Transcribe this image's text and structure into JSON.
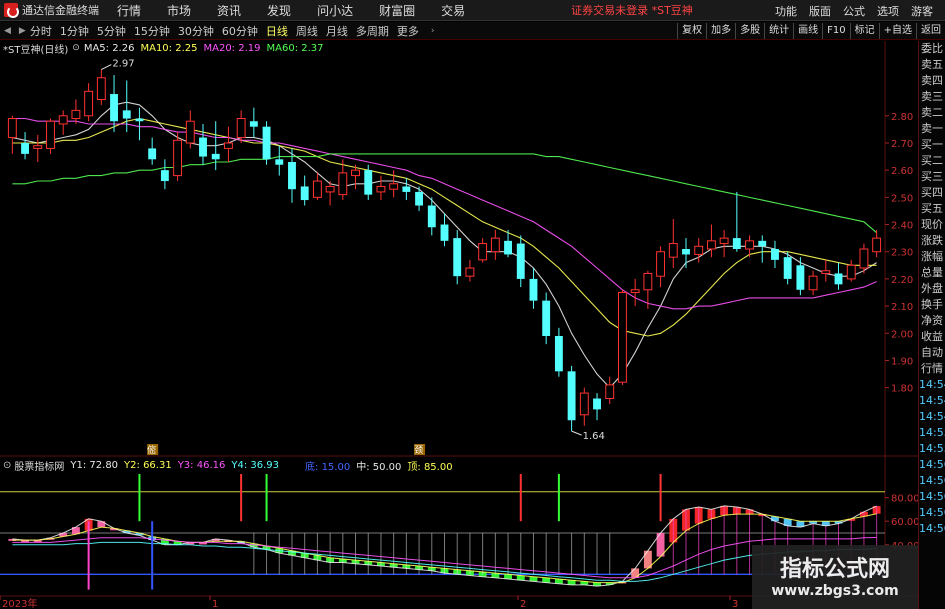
{
  "menu": {
    "app_name": "通达信金融终端",
    "items": [
      "行情",
      "市场",
      "资讯",
      "发现",
      "问小达",
      "财富圈",
      "交易"
    ],
    "notice": "证券交易未登录 *ST豆神",
    "right_items": [
      "功能",
      "版面",
      "公式",
      "选项",
      "游客"
    ]
  },
  "toolbar": {
    "periods": [
      "分时",
      "1分钟",
      "5分钟",
      "15分钟",
      "30分钟",
      "60分钟",
      "日线",
      "周线",
      "月线",
      "多周期",
      "更多"
    ],
    "active_period": "日线",
    "right_buttons": [
      "复权",
      "加多",
      "多股",
      "统计",
      "画线",
      "F10",
      "标记",
      "+自选",
      "返回"
    ]
  },
  "ma_legend": {
    "title": "*ST豆神(日线)",
    "items": [
      {
        "label": "MA5: 2.26",
        "color": "#e8e8e8"
      },
      {
        "label": "MA10: 2.25",
        "color": "#ffff55"
      },
      {
        "label": "MA20: 2.19",
        "color": "#ff55ff"
      },
      {
        "label": "MA60: 2.37",
        "color": "#55ff55"
      }
    ]
  },
  "indicator_legend": {
    "name": "股票指标网",
    "items": [
      {
        "label": "Y1: 72.80",
        "color": "#e8e8e8"
      },
      {
        "label": "Y2: 66.31",
        "color": "#ffff55"
      },
      {
        "label": "Y3: 46.16",
        "color": "#ff55ff"
      },
      {
        "label": "Y4: 36.93",
        "color": "#55ffff"
      },
      {
        "label": "底: 15.00",
        "color": "#4466ff"
      },
      {
        "label": "中: 50.00",
        "color": "#e8e8e8"
      },
      {
        "label": "顶: 85.00",
        "color": "#ffff55"
      }
    ]
  },
  "right_panel": [
    "委比",
    "卖五",
    "卖四",
    "卖三",
    "卖二",
    "卖一",
    "买一",
    "买二",
    "买三",
    "买四",
    "买五",
    "现价",
    "涨跌",
    "涨幅",
    "总量",
    "外盘",
    "换手",
    "净资",
    "收益",
    "自动",
    "行情",
    "14:54",
    "14:54",
    "14:54",
    "14:55",
    "14:55",
    "14:56",
    "14:56",
    "14:56",
    "14:56",
    "14:56"
  ],
  "chart_data": {
    "type": "candlestick",
    "price_axis": {
      "ylim": [
        1.6,
        3.02
      ],
      "ticks": [
        "2.80",
        "2.70",
        "2.60",
        "2.50",
        "2.40",
        "2.30",
        "2.20",
        "2.10",
        "2.00",
        "1.90",
        "1.80"
      ]
    },
    "annotations": {
      "high": "2.97",
      "low": "1.64",
      "flag_1": "㑻",
      "flag_2": "颈"
    },
    "candles": [
      {
        "o": 2.72,
        "h": 2.8,
        "l": 2.66,
        "c": 2.79
      },
      {
        "o": 2.7,
        "h": 2.74,
        "l": 2.64,
        "c": 2.66
      },
      {
        "o": 2.68,
        "h": 2.73,
        "l": 2.63,
        "c": 2.69
      },
      {
        "o": 2.68,
        "h": 2.79,
        "l": 2.66,
        "c": 2.78
      },
      {
        "o": 2.77,
        "h": 2.82,
        "l": 2.73,
        "c": 2.8
      },
      {
        "o": 2.79,
        "h": 2.86,
        "l": 2.77,
        "c": 2.82
      },
      {
        "o": 2.8,
        "h": 2.92,
        "l": 2.78,
        "c": 2.89
      },
      {
        "o": 2.86,
        "h": 2.97,
        "l": 2.84,
        "c": 2.94
      },
      {
        "o": 2.88,
        "h": 2.95,
        "l": 2.74,
        "c": 2.78
      },
      {
        "o": 2.82,
        "h": 2.93,
        "l": 2.74,
        "c": 2.79
      },
      {
        "o": 2.79,
        "h": 2.83,
        "l": 2.71,
        "c": 2.78
      },
      {
        "o": 2.68,
        "h": 2.72,
        "l": 2.62,
        "c": 2.64
      },
      {
        "o": 2.6,
        "h": 2.64,
        "l": 2.53,
        "c": 2.56
      },
      {
        "o": 2.58,
        "h": 2.74,
        "l": 2.56,
        "c": 2.71
      },
      {
        "o": 2.7,
        "h": 2.82,
        "l": 2.68,
        "c": 2.78
      },
      {
        "o": 2.72,
        "h": 2.77,
        "l": 2.62,
        "c": 2.65
      },
      {
        "o": 2.66,
        "h": 2.78,
        "l": 2.6,
        "c": 2.64
      },
      {
        "o": 2.68,
        "h": 2.76,
        "l": 2.63,
        "c": 2.7
      },
      {
        "o": 2.72,
        "h": 2.82,
        "l": 2.7,
        "c": 2.79
      },
      {
        "o": 2.78,
        "h": 2.83,
        "l": 2.72,
        "c": 2.76
      },
      {
        "o": 2.76,
        "h": 2.78,
        "l": 2.62,
        "c": 2.64
      },
      {
        "o": 2.64,
        "h": 2.69,
        "l": 2.58,
        "c": 2.62
      },
      {
        "o": 2.63,
        "h": 2.68,
        "l": 2.48,
        "c": 2.53
      },
      {
        "o": 2.54,
        "h": 2.58,
        "l": 2.47,
        "c": 2.49
      },
      {
        "o": 2.5,
        "h": 2.59,
        "l": 2.49,
        "c": 2.56
      },
      {
        "o": 2.52,
        "h": 2.56,
        "l": 2.47,
        "c": 2.54
      },
      {
        "o": 2.51,
        "h": 2.64,
        "l": 2.49,
        "c": 2.59
      },
      {
        "o": 2.58,
        "h": 2.62,
        "l": 2.53,
        "c": 2.6
      },
      {
        "o": 2.6,
        "h": 2.62,
        "l": 2.49,
        "c": 2.51
      },
      {
        "o": 2.52,
        "h": 2.58,
        "l": 2.49,
        "c": 2.54
      },
      {
        "o": 2.53,
        "h": 2.6,
        "l": 2.5,
        "c": 2.55
      },
      {
        "o": 2.54,
        "h": 2.57,
        "l": 2.49,
        "c": 2.52
      },
      {
        "o": 2.52,
        "h": 2.54,
        "l": 2.45,
        "c": 2.47
      },
      {
        "o": 2.47,
        "h": 2.5,
        "l": 2.36,
        "c": 2.39
      },
      {
        "o": 2.4,
        "h": 2.44,
        "l": 2.32,
        "c": 2.34
      },
      {
        "o": 2.35,
        "h": 2.38,
        "l": 2.18,
        "c": 2.21
      },
      {
        "o": 2.21,
        "h": 2.27,
        "l": 2.19,
        "c": 2.24
      },
      {
        "o": 2.27,
        "h": 2.35,
        "l": 2.26,
        "c": 2.33
      },
      {
        "o": 2.3,
        "h": 2.38,
        "l": 2.27,
        "c": 2.35
      },
      {
        "o": 2.34,
        "h": 2.38,
        "l": 2.28,
        "c": 2.29
      },
      {
        "o": 2.33,
        "h": 2.36,
        "l": 2.17,
        "c": 2.2
      },
      {
        "o": 2.2,
        "h": 2.24,
        "l": 2.09,
        "c": 2.12
      },
      {
        "o": 2.12,
        "h": 2.15,
        "l": 1.96,
        "c": 1.99
      },
      {
        "o": 1.99,
        "h": 2.02,
        "l": 1.84,
        "c": 1.86
      },
      {
        "o": 1.86,
        "h": 1.88,
        "l": 1.64,
        "c": 1.68
      },
      {
        "o": 1.7,
        "h": 1.8,
        "l": 1.66,
        "c": 1.78
      },
      {
        "o": 1.76,
        "h": 1.78,
        "l": 1.68,
        "c": 1.72
      },
      {
        "o": 1.76,
        "h": 1.84,
        "l": 1.74,
        "c": 1.81
      },
      {
        "o": 1.82,
        "h": 2.16,
        "l": 1.81,
        "c": 2.15
      },
      {
        "o": 2.15,
        "h": 2.2,
        "l": 2.1,
        "c": 2.16
      },
      {
        "o": 2.16,
        "h": 2.23,
        "l": 2.09,
        "c": 2.22
      },
      {
        "o": 2.21,
        "h": 2.32,
        "l": 2.17,
        "c": 2.3
      },
      {
        "o": 2.28,
        "h": 2.42,
        "l": 2.24,
        "c": 2.33
      },
      {
        "o": 2.31,
        "h": 2.35,
        "l": 2.24,
        "c": 2.29
      },
      {
        "o": 2.29,
        "h": 2.35,
        "l": 2.26,
        "c": 2.32
      },
      {
        "o": 2.31,
        "h": 2.4,
        "l": 2.28,
        "c": 2.34
      },
      {
        "o": 2.33,
        "h": 2.38,
        "l": 2.28,
        "c": 2.35
      },
      {
        "o": 2.35,
        "h": 2.52,
        "l": 2.3,
        "c": 2.31
      },
      {
        "o": 2.31,
        "h": 2.36,
        "l": 2.28,
        "c": 2.34
      },
      {
        "o": 2.34,
        "h": 2.36,
        "l": 2.26,
        "c": 2.32
      },
      {
        "o": 2.31,
        "h": 2.34,
        "l": 2.24,
        "c": 2.27
      },
      {
        "o": 2.28,
        "h": 2.3,
        "l": 2.18,
        "c": 2.2
      },
      {
        "o": 2.25,
        "h": 2.28,
        "l": 2.14,
        "c": 2.16
      },
      {
        "o": 2.16,
        "h": 2.23,
        "l": 2.14,
        "c": 2.21
      },
      {
        "o": 2.22,
        "h": 2.27,
        "l": 2.19,
        "c": 2.23
      },
      {
        "o": 2.22,
        "h": 2.26,
        "l": 2.16,
        "c": 2.18
      },
      {
        "o": 2.2,
        "h": 2.27,
        "l": 2.19,
        "c": 2.25
      },
      {
        "o": 2.24,
        "h": 2.33,
        "l": 2.22,
        "c": 2.31
      },
      {
        "o": 2.3,
        "h": 2.38,
        "l": 2.28,
        "c": 2.35
      }
    ],
    "ma_lines": [
      {
        "name": "MA5",
        "color": "#e8e8e8",
        "values": [
          2.72,
          2.71,
          2.7,
          2.71,
          2.72,
          2.73,
          2.75,
          2.8,
          2.84,
          2.85,
          2.84,
          2.8,
          2.75,
          2.72,
          2.7,
          2.69,
          2.69,
          2.7,
          2.72,
          2.72,
          2.71,
          2.69,
          2.66,
          2.63,
          2.59,
          2.55,
          2.54,
          2.55,
          2.55,
          2.56,
          2.56,
          2.55,
          2.53,
          2.49,
          2.44,
          2.39,
          2.34,
          2.3,
          2.3,
          2.3,
          2.28,
          2.24,
          2.18,
          2.1,
          2.0,
          1.92,
          1.85,
          1.8,
          1.85,
          1.93,
          2.02,
          2.1,
          2.2,
          2.26,
          2.28,
          2.31,
          2.32,
          2.32,
          2.32,
          2.32,
          2.31,
          2.29,
          2.26,
          2.24,
          2.22,
          2.21,
          2.21,
          2.23,
          2.26
        ]
      },
      {
        "name": "MA10",
        "color": "#ffff55",
        "values": [
          2.7,
          2.7,
          2.7,
          2.7,
          2.71,
          2.71,
          2.72,
          2.74,
          2.76,
          2.78,
          2.79,
          2.78,
          2.77,
          2.76,
          2.75,
          2.74,
          2.73,
          2.72,
          2.71,
          2.7,
          2.7,
          2.69,
          2.68,
          2.67,
          2.65,
          2.63,
          2.62,
          2.61,
          2.6,
          2.59,
          2.58,
          2.57,
          2.55,
          2.53,
          2.5,
          2.47,
          2.44,
          2.41,
          2.39,
          2.37,
          2.35,
          2.32,
          2.28,
          2.24,
          2.19,
          2.14,
          2.09,
          2.04,
          2.01,
          2.0,
          1.99,
          2.0,
          2.03,
          2.07,
          2.12,
          2.17,
          2.22,
          2.26,
          2.29,
          2.3,
          2.3,
          2.3,
          2.29,
          2.28,
          2.27,
          2.26,
          2.25,
          2.25,
          2.25
        ]
      },
      {
        "name": "MA20",
        "color": "#ff55ff",
        "values": [
          2.79,
          2.79,
          2.78,
          2.78,
          2.78,
          2.78,
          2.77,
          2.77,
          2.77,
          2.77,
          2.76,
          2.76,
          2.75,
          2.74,
          2.74,
          2.73,
          2.72,
          2.72,
          2.71,
          2.71,
          2.7,
          2.7,
          2.69,
          2.68,
          2.67,
          2.66,
          2.65,
          2.64,
          2.63,
          2.62,
          2.61,
          2.6,
          2.58,
          2.57,
          2.55,
          2.53,
          2.51,
          2.49,
          2.47,
          2.45,
          2.43,
          2.41,
          2.38,
          2.35,
          2.32,
          2.28,
          2.24,
          2.2,
          2.16,
          2.13,
          2.11,
          2.1,
          2.09,
          2.09,
          2.1,
          2.1,
          2.11,
          2.12,
          2.13,
          2.13,
          2.13,
          2.13,
          2.13,
          2.13,
          2.14,
          2.15,
          2.16,
          2.17,
          2.19
        ]
      },
      {
        "name": "MA60",
        "color": "#55ff55",
        "values": [
          2.55,
          2.55,
          2.56,
          2.56,
          2.57,
          2.57,
          2.58,
          2.58,
          2.59,
          2.59,
          2.6,
          2.6,
          2.61,
          2.61,
          2.62,
          2.62,
          2.63,
          2.63,
          2.64,
          2.64,
          2.64,
          2.65,
          2.65,
          2.65,
          2.65,
          2.66,
          2.66,
          2.66,
          2.66,
          2.66,
          2.66,
          2.66,
          2.66,
          2.66,
          2.66,
          2.66,
          2.66,
          2.66,
          2.66,
          2.66,
          2.66,
          2.66,
          2.65,
          2.65,
          2.64,
          2.63,
          2.62,
          2.61,
          2.6,
          2.59,
          2.58,
          2.57,
          2.56,
          2.55,
          2.54,
          2.53,
          2.52,
          2.51,
          2.5,
          2.49,
          2.48,
          2.47,
          2.46,
          2.45,
          2.44,
          2.43,
          2.42,
          2.41,
          2.37
        ]
      }
    ],
    "indicator": {
      "ylim": [
        0,
        100
      ],
      "ticks": [
        "80.00",
        "60.00",
        "40.00"
      ],
      "bottom": 15,
      "middle": 50,
      "top": 85,
      "y1": [
        45,
        44,
        44,
        46,
        50,
        55,
        62,
        60,
        54,
        50,
        48,
        44,
        40,
        40,
        42,
        42,
        45,
        44,
        42,
        38,
        36,
        33,
        31,
        29,
        27,
        25,
        25,
        24,
        23,
        22,
        21,
        20,
        19,
        18,
        16,
        15,
        14,
        13,
        12,
        11,
        10,
        9,
        8,
        7,
        6,
        6,
        5,
        6,
        9,
        20,
        35,
        50,
        62,
        70,
        72,
        70,
        73,
        72,
        70,
        66,
        60,
        56,
        55,
        58,
        56,
        58,
        62,
        68,
        72.8
      ],
      "y2": [
        44,
        44,
        44,
        45,
        47,
        49,
        52,
        55,
        54,
        52,
        50,
        47,
        45,
        43,
        42,
        42,
        43,
        43,
        43,
        41,
        39,
        37,
        35,
        33,
        31,
        29,
        28,
        27,
        26,
        25,
        24,
        23,
        22,
        21,
        20,
        19,
        18,
        17,
        16,
        15,
        14,
        13,
        12,
        11,
        10,
        9,
        8,
        8,
        8,
        12,
        20,
        30,
        42,
        52,
        58,
        62,
        65,
        66,
        66,
        66,
        64,
        62,
        60,
        60,
        60,
        60,
        62,
        64,
        66.31
      ],
      "y3": [
        42,
        42,
        42,
        42,
        43,
        44,
        45,
        46,
        46,
        46,
        46,
        45,
        44,
        43,
        42,
        42,
        42,
        41,
        41,
        40,
        39,
        38,
        37,
        36,
        35,
        34,
        33,
        32,
        31,
        30,
        29,
        28,
        27,
        26,
        25,
        24,
        23,
        22,
        21,
        20,
        19,
        18,
        17,
        16,
        15,
        14,
        13,
        12,
        12,
        12,
        14,
        18,
        22,
        27,
        32,
        36,
        39,
        41,
        43,
        44,
        45,
        45,
        45,
        45,
        45,
        45,
        45,
        46,
        46.16
      ],
      "y4": [
        40,
        40,
        40,
        40,
        40,
        41,
        41,
        42,
        42,
        42,
        42,
        41,
        41,
        40,
        40,
        39,
        39,
        38,
        38,
        37,
        36,
        35,
        34,
        33,
        32,
        31,
        30,
        29,
        28,
        27,
        26,
        25,
        24,
        23,
        22,
        21,
        20,
        19,
        18,
        17,
        16,
        15,
        14,
        13,
        12,
        11,
        10,
        10,
        9,
        9,
        10,
        12,
        15,
        18,
        21,
        24,
        27,
        29,
        31,
        32,
        33,
        34,
        34,
        35,
        35,
        36,
        36,
        36,
        36.93
      ]
    },
    "x_axis_labels": [
      "2023年",
      "1",
      "2",
      "3"
    ]
  }
}
